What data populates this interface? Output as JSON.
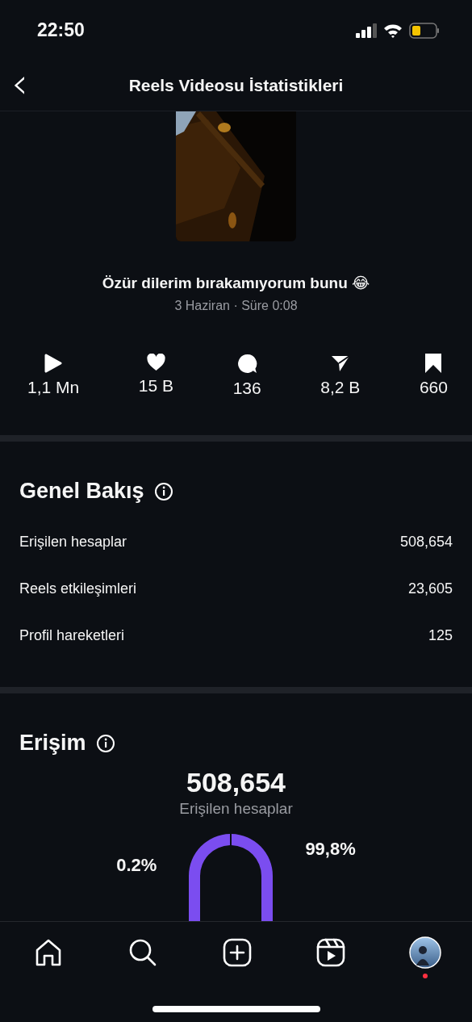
{
  "status_bar": {
    "time": "22:50"
  },
  "header": {
    "back": "‹",
    "title": "Reels Videosu İstatistikleri"
  },
  "video": {
    "kind": "picture",
    "caption": "Özür dilerim bırakamıyorum bunu 😂",
    "meta": "3 Haziran · Süre 0:08"
  },
  "stats": [
    {
      "kind": "plays",
      "value": "1,1 Mn"
    },
    {
      "kind": "likes",
      "value": "15 B"
    },
    {
      "kind": "comments",
      "value": "136"
    },
    {
      "kind": "shares",
      "value": "8,2 B"
    },
    {
      "kind": "saves",
      "value": "660"
    }
  ],
  "overview": {
    "title": "Genel Bakış",
    "rows": [
      {
        "label": "Erişilen hesaplar",
        "value": "508,654"
      },
      {
        "label": "Reels etkileşimleri",
        "value": "23,605"
      },
      {
        "label": "Profil hareketleri",
        "value": "125"
      }
    ]
  },
  "reach": {
    "title": "Erişim",
    "total": "508,654",
    "total_label": "Erişilen hesaplar",
    "left_label": "0.2%",
    "right_label": "99,8%"
  },
  "tab_bar": [
    {
      "kind": "home"
    },
    {
      "kind": "search"
    },
    {
      "kind": "create"
    },
    {
      "kind": "reels"
    },
    {
      "kind": "profile",
      "badge": true
    }
  ]
}
